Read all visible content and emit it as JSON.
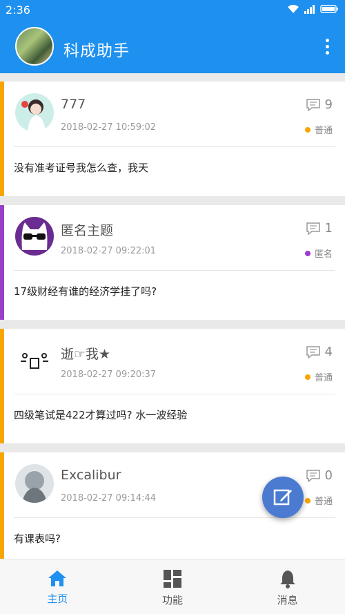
{
  "status_bar": {
    "time": "2:36"
  },
  "app_bar": {
    "title": "科成助手"
  },
  "colors": {
    "primary": "#1e90f0",
    "normal_tag": "#f7a500",
    "anon_tag": "#9b3fc7",
    "fab": "#4a7bd0"
  },
  "posts": [
    {
      "name": "777",
      "time": "2018-02-27 10:59:02",
      "comments": "9",
      "tag": "普通",
      "content": "没有准考证号我怎么查，我天"
    },
    {
      "name": "匿名主题",
      "time": "2018-02-27 09:22:01",
      "comments": "1",
      "tag": "匿名",
      "content": "17级财经有谁的经济学挂了吗?"
    },
    {
      "name": "逝☞我★",
      "time": "2018-02-27 09:20:37",
      "comments": "4",
      "tag": "普通",
      "content": "四级笔试是422才算过吗? 水一波经验"
    },
    {
      "name": "Excalibur",
      "time": "2018-02-27 09:14:44",
      "comments": "0",
      "tag": "普通",
      "content": "有课表吗?"
    }
  ],
  "bottom_nav": [
    {
      "label": "主页",
      "icon": "home-icon",
      "active": true
    },
    {
      "label": "功能",
      "icon": "grid-icon",
      "active": false
    },
    {
      "label": "消息",
      "icon": "bell-icon",
      "active": false
    }
  ]
}
